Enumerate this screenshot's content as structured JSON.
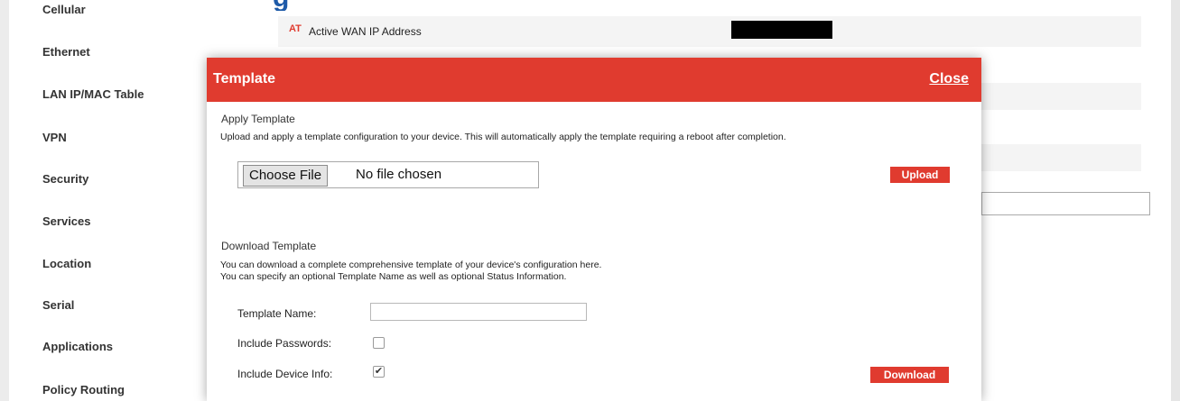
{
  "sidebar": {
    "items": [
      {
        "label": "Cellular"
      },
      {
        "label": "Ethernet"
      },
      {
        "label": "LAN IP/MAC Table"
      },
      {
        "label": "VPN"
      },
      {
        "label": "Security"
      },
      {
        "label": "Services"
      },
      {
        "label": "Location"
      },
      {
        "label": "Serial"
      },
      {
        "label": "Applications"
      },
      {
        "label": "Policy Routing"
      }
    ]
  },
  "background": {
    "heading_fragment": "g",
    "wan_row": {
      "badge": "AT",
      "label": "Active WAN IP Address"
    }
  },
  "modal": {
    "title": "Template",
    "close_label": "Close",
    "apply": {
      "title": "Apply Template",
      "description": "Upload and apply a template configuration to your device. This will automatically apply the template requiring a reboot after completion.",
      "choose_file_label": "Choose File",
      "file_status": "No file chosen",
      "upload_label": "Upload"
    },
    "download": {
      "title": "Download Template",
      "description_line1": "You can download a complete comprehensive template of your device's configuration here.",
      "description_line2": "You can specify an optional Template Name as well as optional Status Information.",
      "template_name_label": "Template Name:",
      "template_name_value": "",
      "include_passwords_label": "Include Passwords:",
      "include_passwords_checked": false,
      "include_device_info_label": "Include Device Info:",
      "include_device_info_checked": true,
      "download_label": "Download"
    }
  },
  "colors": {
    "accent_red": "#e03b2f",
    "heading_blue": "#1e5aa8"
  }
}
